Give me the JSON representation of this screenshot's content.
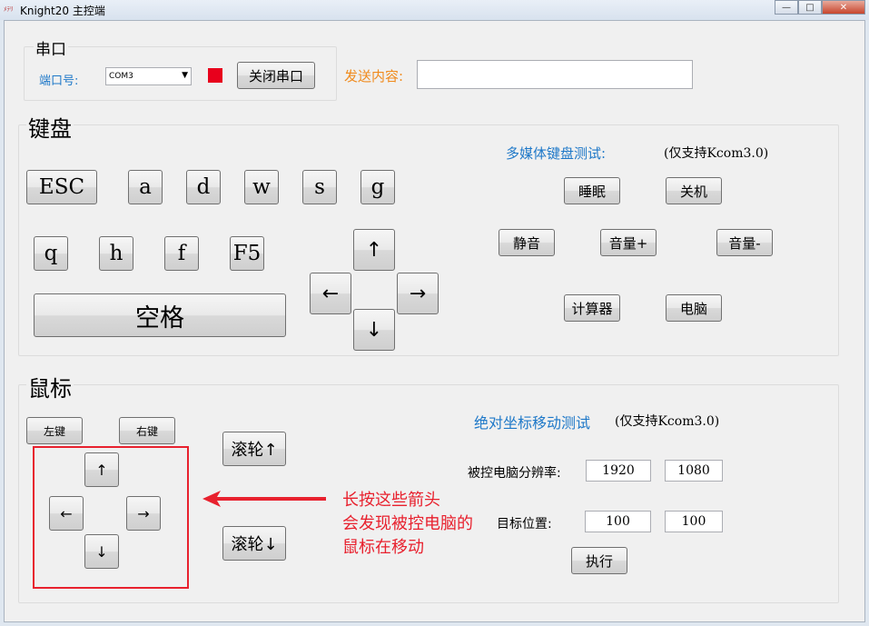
{
  "window": {
    "title": "Knight20 主控端",
    "icon_text": "ﾒﾃﾘ",
    "min_glyph": "—",
    "max_glyph": "□",
    "close_glyph": "✕"
  },
  "serial": {
    "title": "串口",
    "port_label": "端口号:",
    "port_value": "COM3",
    "close_button": "关闭串口",
    "indicator_color": "#e8001c",
    "send_label": "发送内容:",
    "send_value": ""
  },
  "keyboard": {
    "title": "键盘",
    "keys_row1": [
      "ESC",
      "a",
      "d",
      "w",
      "s",
      "g"
    ],
    "keys_row2": [
      "q",
      "h",
      "f",
      "F5"
    ],
    "space": "空格",
    "arrow_up": "↑",
    "arrow_left": "←",
    "arrow_right": "→",
    "arrow_down": "↓",
    "media_title": "多媒体键盘测试:",
    "media_note": "(仅支持Kcom3.0)",
    "media_buttons": {
      "sleep": "睡眠",
      "shutdown": "关机",
      "mute": "静音",
      "vol_up": "音量+",
      "vol_down": "音量-",
      "calculator": "计算器",
      "computer": "电脑"
    }
  },
  "mouse": {
    "title": "鼠标",
    "left_button": "左键",
    "right_button": "右键",
    "wheel_up": "滚轮↑",
    "wheel_down": "滚轮↓",
    "arrow_up": "↑",
    "arrow_left": "←",
    "arrow_right": "→",
    "arrow_down": "↓",
    "abs_title": "绝对坐标移动测试",
    "abs_note": "(仅支持Kcom3.0)",
    "resolution_label": "被控电脑分辨率:",
    "res_w": "1920",
    "res_h": "1080",
    "target_label": "目标位置:",
    "target_x": "100",
    "target_y": "100",
    "execute": "执行",
    "annotation": [
      "长按这些箭头",
      "会发现被控电脑的",
      "鼠标在移动"
    ],
    "annotation_color": "#e8212e"
  }
}
